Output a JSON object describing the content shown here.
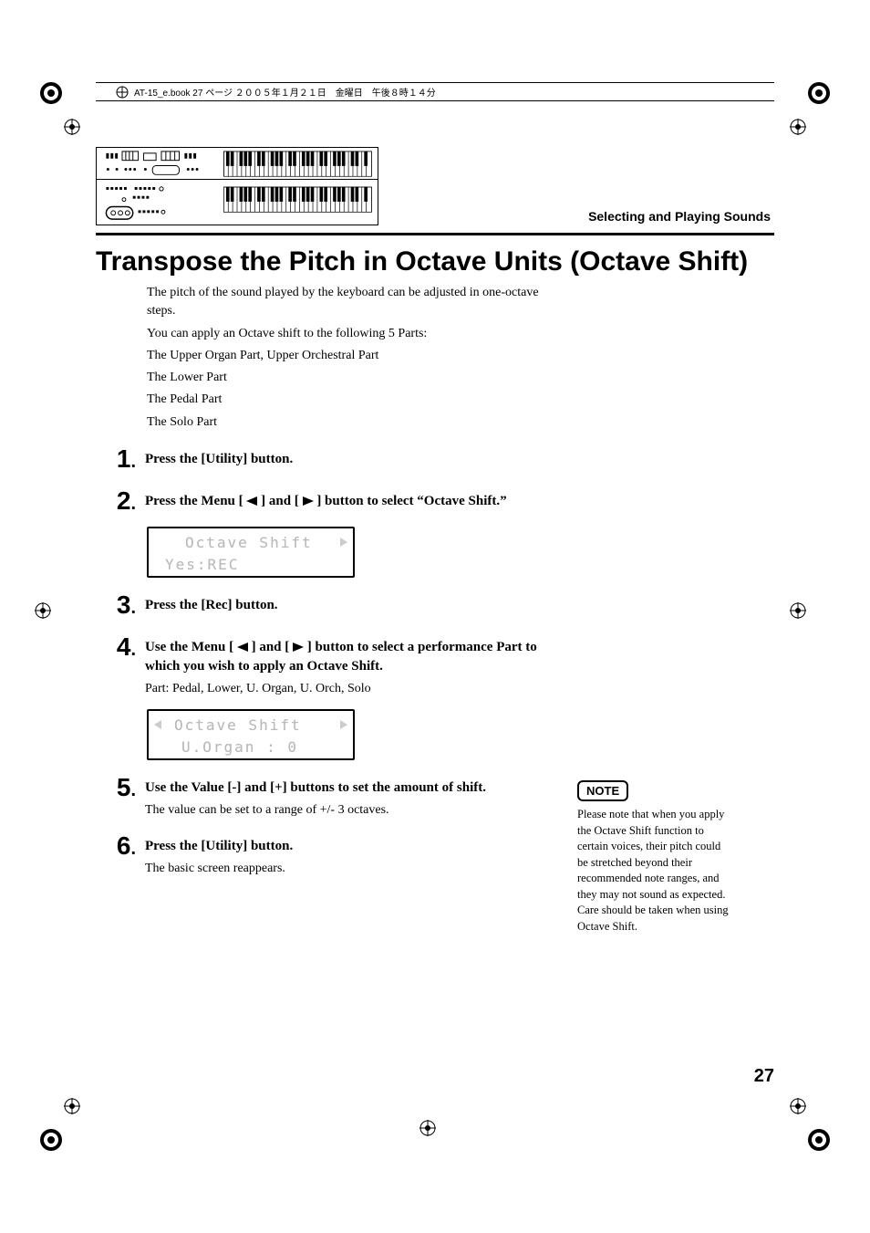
{
  "header": {
    "meta_line": "AT-15_e.book  27 ページ  ２００５年１月２１日　金曜日　午後８時１４分"
  },
  "section_label": "Selecting and Playing Sounds",
  "title": "Transpose the Pitch in Octave Units (Octave Shift)",
  "intro": {
    "p1": "The pitch of the sound played by the keyboard can be adjusted in one-octave steps.",
    "p2": "You can apply an Octave shift to the following 5 Parts:",
    "p3": "The Upper Organ Part, Upper Orchestral Part",
    "p4": "The Lower Part",
    "p5": "The Pedal Part",
    "p6": "The Solo Part"
  },
  "steps": {
    "s1": {
      "num": "1",
      "instr": "Press the [Utility] button."
    },
    "s2": {
      "num": "2",
      "instr_pre": "Press the Menu [ ",
      "instr_mid": " ] and [ ",
      "instr_post": " ] button to select “Octave Shift.”"
    },
    "lcd1": {
      "line1": "Octave Shift",
      "line2": "Yes:REC"
    },
    "s3": {
      "num": "3",
      "instr": "Press the [Rec] button."
    },
    "s4": {
      "num": "4",
      "instr_pre": "Use the Menu [ ",
      "instr_mid": " ] and [ ",
      "instr_post": " ] button to select a performance Part to which you wish to apply an Octave Shift.",
      "detail": "Part: Pedal, Lower, U. Organ, U. Orch, Solo"
    },
    "lcd2": {
      "line1": "  Octave Shift",
      "line2": "U.Organ :    0"
    },
    "s5": {
      "num": "5",
      "instr": "Use the Value [-] and [+] buttons to set the amount of shift.",
      "detail": "The value can be set to a range of +/- 3 octaves."
    },
    "s6": {
      "num": "6",
      "instr": "Press the [Utility] button.",
      "detail": "The basic screen reappears."
    }
  },
  "note": {
    "badge": "NOTE",
    "text": "Please note that when you apply the Octave Shift function to certain voices, their pitch could be stretched beyond their recommended note ranges, and they may not sound as expected. Care should be taken when using Octave Shift."
  },
  "page_number": "27"
}
